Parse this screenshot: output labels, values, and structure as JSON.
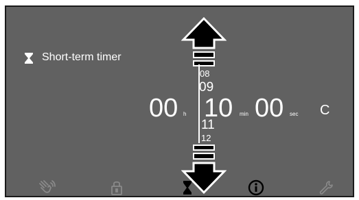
{
  "timer": {
    "title": "Short-term timer",
    "hours": "00",
    "hours_unit": "h",
    "minutes": "10",
    "minutes_unit": "min",
    "seconds": "00",
    "seconds_unit": "sec",
    "clear_label": "C"
  },
  "minute_scroll": {
    "above2": "08",
    "above1": "09",
    "below1": "11",
    "below2": "12"
  },
  "bottom_bar": {
    "icons": [
      "hand-wave-icon",
      "lock-icon",
      "hourglass-icon",
      "info-icon",
      "wrench-icon"
    ]
  },
  "colors": {
    "panel": "#616161",
    "foreground": "#ffffff",
    "icon_dim": "#8a8a8a",
    "active_icon": "#000000"
  }
}
